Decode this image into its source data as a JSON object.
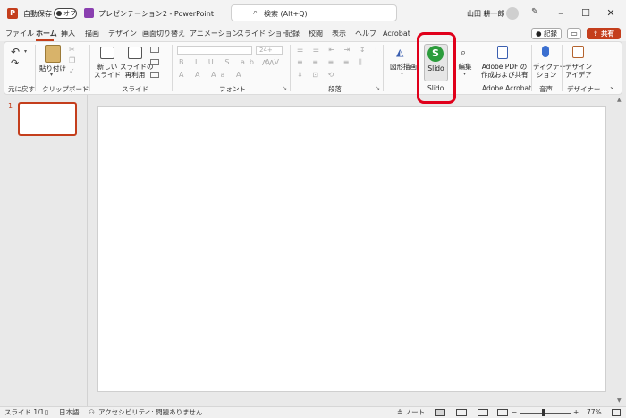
{
  "titlebar": {
    "autosave_label": "自動保存",
    "autosave_state": "オフ",
    "doc_title": "プレゼンテーション2 - PowerPoint",
    "search_placeholder": "検索 (Alt+Q)",
    "user_name": "山田 耕一郎"
  },
  "tabs": [
    "ファイル",
    "ホーム",
    "挿入",
    "描画",
    "デザイン",
    "画面切り替え",
    "アニメーション",
    "スライド ショー",
    "記録",
    "校閲",
    "表示",
    "ヘルプ",
    "Acrobat"
  ],
  "active_tab": "ホーム",
  "header_buttons": {
    "record": "記録",
    "share": "共有"
  },
  "ribbon": {
    "groups": {
      "undo": "元に戻す",
      "clipboard": "クリップボード",
      "slides": "スライド",
      "font": "フォント",
      "paragraph": "段落",
      "slido": "Slido",
      "adobe": "Adobe Acrobat",
      "voice": "音声",
      "designer": "デザイナー"
    },
    "buttons": {
      "paste": "貼り付け",
      "new_slide": "新しい\nスライド",
      "reuse_slides": "スライドの\n再利用",
      "font_size": "24+",
      "shapes": "図形描画",
      "slido": "Slido",
      "edit": "編集",
      "adobe_pdf": "Adobe PDF の\n作成および共有",
      "dictate": "ディクテー\nション",
      "design_ideas": "デザイン\nアイデア"
    }
  },
  "thumbnails": {
    "number": "1"
  },
  "statusbar": {
    "slide_info": "スライド 1/1",
    "language": "日本語",
    "accessibility": "アクセシビリティ: 問題ありません",
    "notes": "ノート",
    "zoom": "77%"
  },
  "colors": {
    "accent": "#c43e1c",
    "highlight": "#e0001b",
    "slido_green": "#2c9c3c"
  }
}
